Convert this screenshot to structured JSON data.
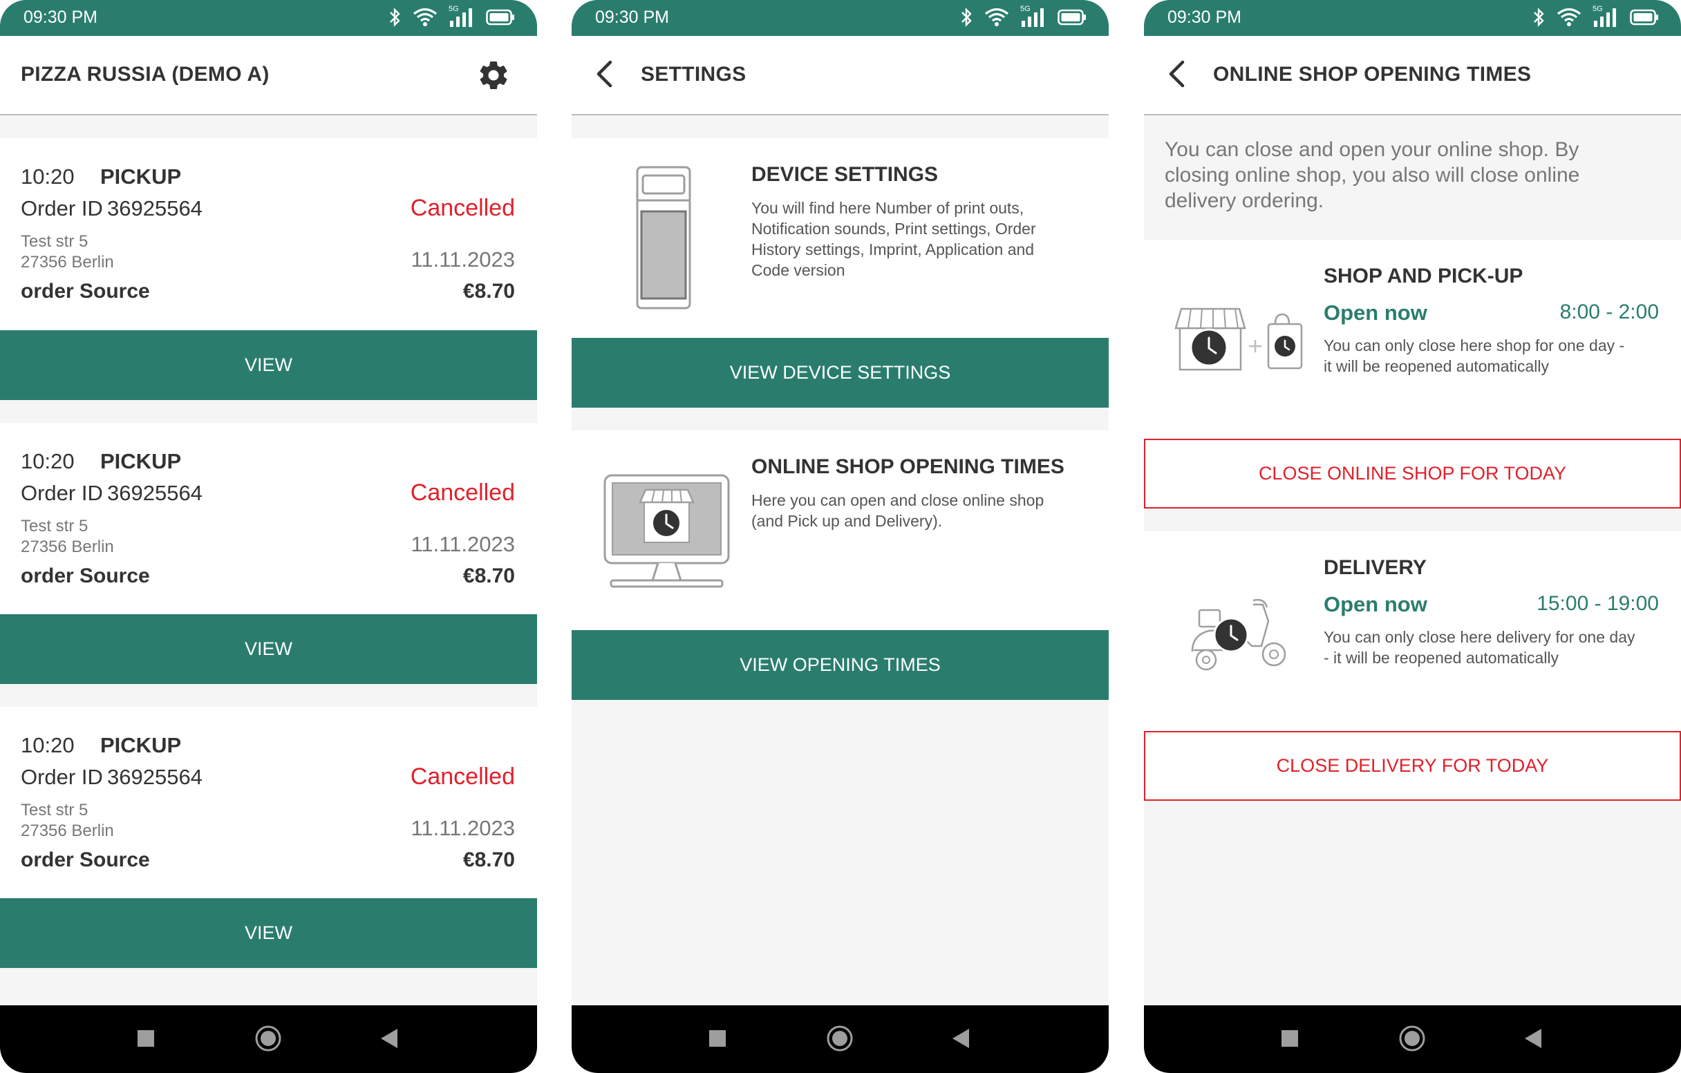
{
  "status_bar": {
    "time": "09:30 PM",
    "network": "5G"
  },
  "colors": {
    "brand_green": "#2a7d6d",
    "cancel_red": "#e0202a",
    "nav_black": "#000000"
  },
  "orders_screen": {
    "title": "PIZZA RUSSIA (DEMO A)",
    "orders": [
      {
        "time": "10:20",
        "type": "PICKUP",
        "order_id_label": "Order ID",
        "order_id": "36925564",
        "status": "Cancelled",
        "street": "Test str 5",
        "city": "27356 Berlin",
        "date": "11.11.2023",
        "source_label": "order Source",
        "amount": "€8.70",
        "button": "VIEW"
      },
      {
        "time": "10:20",
        "type": "PICKUP",
        "order_id_label": "Order ID",
        "order_id": "36925564",
        "status": "Cancelled",
        "street": "Test str 5",
        "city": "27356 Berlin",
        "date": "11.11.2023",
        "source_label": "order Source",
        "amount": "€8.70",
        "button": "VIEW"
      },
      {
        "time": "10:20",
        "type": "PICKUP",
        "order_id_label": "Order ID",
        "order_id": "36925564",
        "status": "Cancelled",
        "street": "Test str 5",
        "city": "27356 Berlin",
        "date": "11.11.2023",
        "source_label": "order Source",
        "amount": "€8.70",
        "button": "VIEW"
      }
    ]
  },
  "settings_screen": {
    "title": "SETTINGS",
    "device": {
      "heading": "DEVICE SETTINGS",
      "desc_lines": [
        "You will find here Number of print outs,",
        "Notification sounds, Print settings, Order",
        "History settings, Imprint, Application and",
        "Code version"
      ],
      "button": "VIEW DEVICE SETTINGS"
    },
    "opening": {
      "heading": "ONLINE SHOP OPENING TIMES",
      "desc_lines": [
        "Here you can open and close online shop",
        "(and Pick up and Delivery)."
      ],
      "button": "VIEW OPENING TIMES"
    }
  },
  "opening_screen": {
    "title": "ONLINE SHOP OPENING TIMES",
    "intro_lines": [
      "You can close and open your online shop. By",
      "closing online shop, you also will close online",
      "delivery ordering."
    ],
    "pickup": {
      "heading": "SHOP AND PICK-UP",
      "status": "Open now",
      "hours": "8:00 - 2:00",
      "note_lines": [
        "You can only close here shop for one day -",
        "it will be reopened automatically"
      ],
      "button": "CLOSE ONLINE SHOP FOR TODAY"
    },
    "delivery": {
      "heading": "DELIVERY",
      "status": "Open now",
      "hours": "15:00 - 19:00",
      "note_lines": [
        "You can only close here delivery for one day",
        "- it will be reopened automatically"
      ],
      "button": "CLOSE DELIVERY FOR TODAY"
    }
  }
}
